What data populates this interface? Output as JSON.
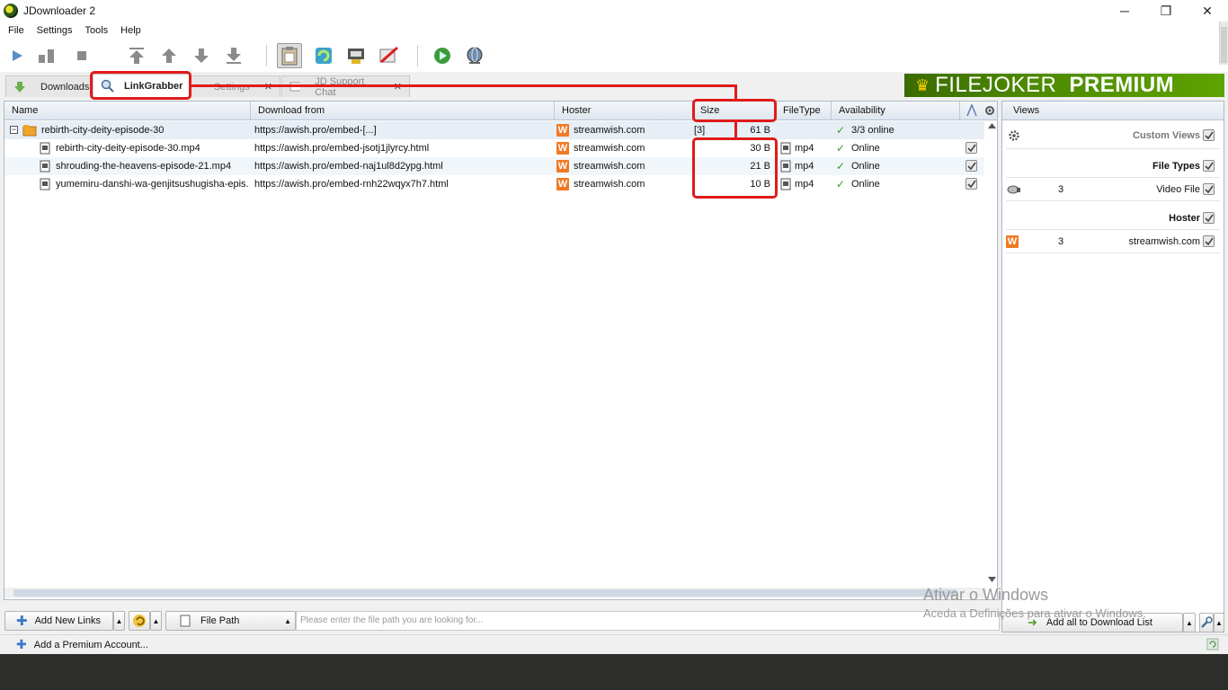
{
  "window": {
    "title": "JDownloader 2",
    "minimize": "─",
    "maximize": "❐",
    "close": "✕"
  },
  "menu": [
    "File",
    "Settings",
    "Tools",
    "Help"
  ],
  "tabs": [
    {
      "label": "Downloads"
    },
    {
      "label": "LinkGrabber"
    },
    {
      "label": "Settings"
    },
    {
      "label": "JD Support Chat"
    }
  ],
  "banner": {
    "brand": "FILEJOKER",
    "tag": "PREMIUM"
  },
  "table": {
    "columns": [
      "Name",
      "Download from",
      "Hoster",
      "Size",
      "FileType",
      "Availability"
    ],
    "package": {
      "name": "rebirth-city-deity-episode-30",
      "download_from": "https://awish.pro/embed-[...]",
      "hoster": "streamwish.com",
      "count": "[3]",
      "size": "61 B",
      "availability": "3/3 online"
    },
    "rows": [
      {
        "name": "rebirth-city-deity-episode-30.mp4",
        "download_from": "https://awish.pro/embed-jsotj1jlyrcy.html",
        "hoster": "streamwish.com",
        "size": "30 B",
        "filetype": "mp4",
        "availability": "Online"
      },
      {
        "name": "shrouding-the-heavens-episode-21.mp4",
        "download_from": "https://awish.pro/embed-naj1ul8d2ypg.html",
        "hoster": "streamwish.com",
        "size": "21 B",
        "filetype": "mp4",
        "availability": "Online"
      },
      {
        "name": "yumemiru-danshi-wa-genjitsushugisha-epis...",
        "download_from": "https://awish.pro/embed-rnh22wqyx7h7.html",
        "hoster": "streamwish.com",
        "size": "10 B",
        "filetype": "mp4",
        "availability": "Online"
      }
    ]
  },
  "views": {
    "header": "Views",
    "custom_views": "Custom Views",
    "file_types": "File Types",
    "video_count": "3",
    "video_label": "Video File",
    "hoster_heading": "Hoster",
    "hoster_count": "3",
    "hoster_name": "streamwish.com"
  },
  "bottom": {
    "add_links": "Add New Links",
    "file_path": "File Path",
    "search_placeholder": "Please enter the file path you are looking for...",
    "add_all": "Add all to Download List"
  },
  "status": {
    "premium": "Add a Premium Account..."
  },
  "watermark": {
    "line1": "Ativar o Windows",
    "line2": "Aceda a Definições para ativar o Windows."
  },
  "colors": {
    "annotation": "#e01b1b",
    "hoster_icon": "#f07a24",
    "banner_green": "#4d8a00"
  }
}
